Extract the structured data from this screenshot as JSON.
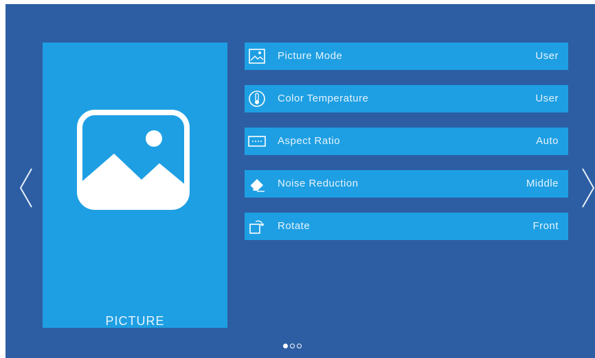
{
  "category": {
    "title": "PICTURE",
    "icon": "picture-icon"
  },
  "menu": {
    "items": [
      {
        "icon": "picture-mode-icon",
        "label": "Picture Mode",
        "value": "User"
      },
      {
        "icon": "thermometer-icon",
        "label": "Color Temperature",
        "value": "User"
      },
      {
        "icon": "aspect-ratio-icon",
        "label": "Aspect Ratio",
        "value": "Auto"
      },
      {
        "icon": "eraser-icon",
        "label": "Noise Reduction",
        "value": "Middle"
      },
      {
        "icon": "rotate-icon",
        "label": "Rotate",
        "value": "Front"
      }
    ]
  },
  "navigation": {
    "left_icon": "chevron-left-icon",
    "right_icon": "chevron-right-icon"
  },
  "pagination": {
    "total_pages": 3,
    "current_page": 1
  },
  "colors": {
    "background": "#2d5ea3",
    "tile": "#1e9fe3",
    "text": "#e6f3fc"
  }
}
